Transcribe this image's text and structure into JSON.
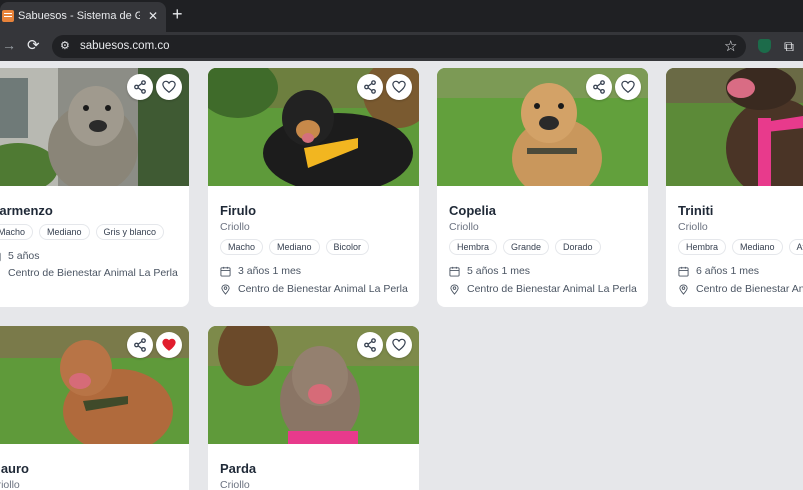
{
  "browser": {
    "tab_title": "Sabuesos - Sistema de Gestión",
    "tab_close": "✕",
    "new_tab": "+",
    "url": "sabuesos.com.co"
  },
  "cards": [
    {
      "name": "Carmenzo",
      "breed": "",
      "tags": [
        "Macho",
        "Mediano",
        "Gris y blanco"
      ],
      "age": "5 años",
      "location": "Centro de Bienestar Animal La Perla",
      "favorited": false
    },
    {
      "name": "Firulo",
      "breed": "Criollo",
      "tags": [
        "Macho",
        "Mediano",
        "Bicolor"
      ],
      "age": "3 años 1 mes",
      "location": "Centro de Bienestar Animal La Perla",
      "favorited": false
    },
    {
      "name": "Copelia",
      "breed": "Criollo",
      "tags": [
        "Hembra",
        "Grande",
        "Dorado"
      ],
      "age": "5 años 1 mes",
      "location": "Centro de Bienestar Animal La Perla",
      "favorited": false
    },
    {
      "name": "Triniti",
      "breed": "Criollo",
      "tags": [
        "Hembra",
        "Mediano",
        "Atigrado"
      ],
      "age": "6 años 1 mes",
      "location": "Centro de Bienestar Animal La Perla",
      "favorited": false
    },
    {
      "name": "Mauro",
      "breed": "Criollo",
      "favorited": true
    },
    {
      "name": "Parda",
      "breed": "Criollo",
      "favorited": false
    }
  ],
  "colors": {
    "heart_active": "#e11d2e",
    "icon": "#374151",
    "grass": "#4f8a2f"
  }
}
